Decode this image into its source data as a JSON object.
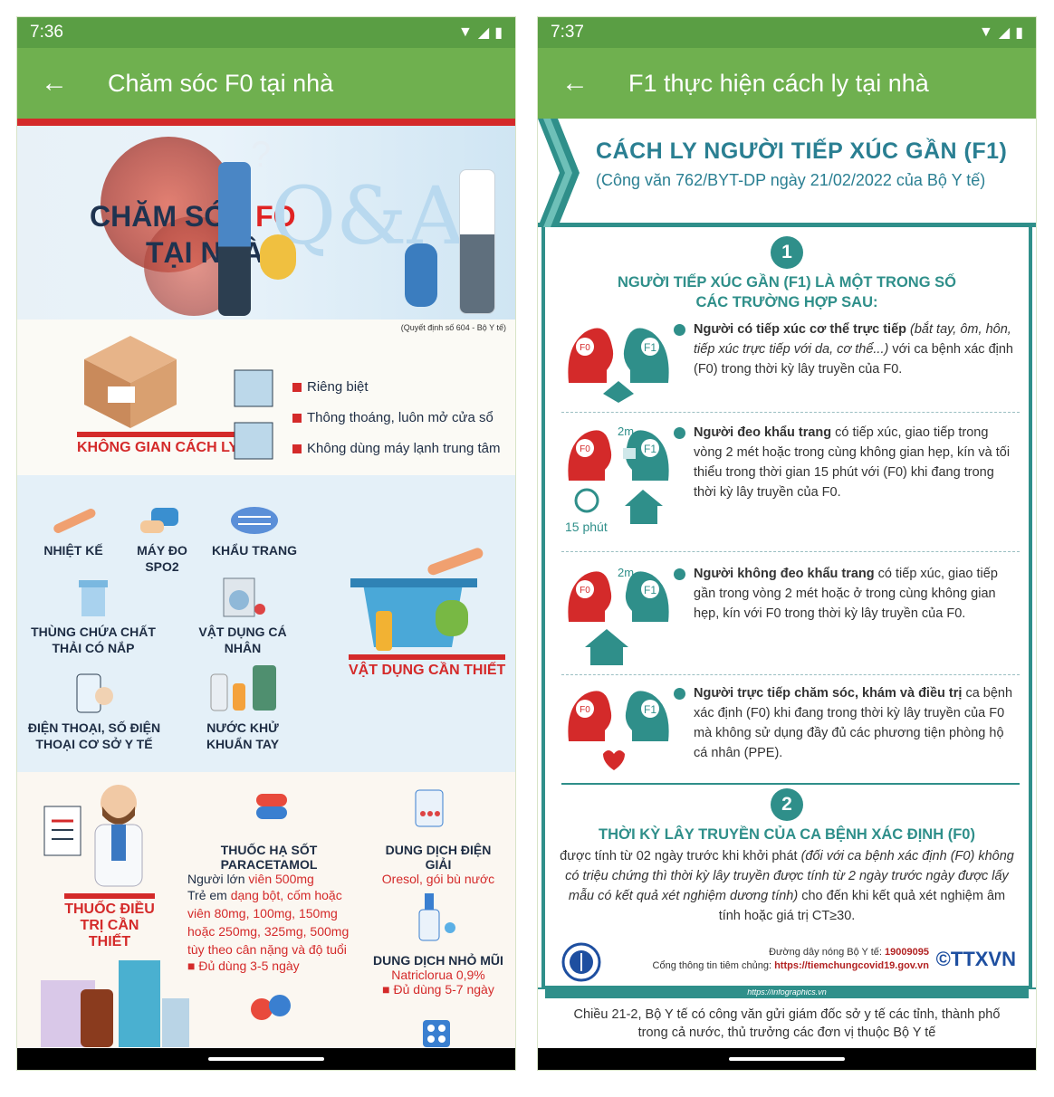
{
  "left": {
    "status": {
      "time": "7:36"
    },
    "appbar": {
      "title": "Chăm sóc F0 tại nhà"
    },
    "hero": {
      "line1": "CHĂM SÓC ",
      "line1_red": "FO",
      "line2": "TẠI NHÀ",
      "qa": "Q&A",
      "source": "(Quyết định số 604 - Bộ Y tế)"
    },
    "isolation": {
      "label": "KHÔNG GIAN CÁCH LY",
      "bullets": [
        "Riêng biệt",
        "Thông thoáng, luôn mở cửa sổ",
        "Không dùng máy lạnh trung tâm"
      ]
    },
    "supplies": {
      "label": "VẬT DỤNG CẦN THIẾT",
      "items": {
        "thermometer": "NHIỆT KẾ",
        "spo2": "MÁY ĐO SPO2",
        "mask": "KHẨU TRANG",
        "bin": "THÙNG CHỨA CHẤT THẢI CÓ NẮP",
        "personal": "VẬT DỤNG CÁ NHÂN",
        "phone": "ĐIỆN THOẠI, SỐ ĐIỆN THOẠI CƠ SỞ Y TẾ",
        "sanitizer": "NƯỚC KHỬ KHUẨN TAY"
      }
    },
    "medicine": {
      "label": "THUỐC ĐIỀU TRỊ CẦN THIẾT",
      "para_title": "THUỐC HẠ SỐT PARACETAMOL",
      "para_adult_prefix": "Người lớn ",
      "para_adult": "viên 500mg",
      "para_child_prefix": "Trẻ em ",
      "para_child": "dạng bột, cốm hoặc viên 80mg, 100mg, 150mg hoặc 250mg, 325mg, 500mg tùy theo cân nặng và độ tuổi",
      "para_days": "Đủ dùng 3-5 ngày",
      "oresol_title": "DUNG DỊCH ĐIỆN GIẢI",
      "oresol_sub": "Oresol, gói bù nước",
      "nasal_title": "DUNG DỊCH NHỎ MŨI",
      "nasal_sub": "Natriclorua 0,9%",
      "nasal_days": "Đủ dùng 5-7 ngày"
    }
  },
  "right": {
    "status": {
      "time": "7:37"
    },
    "appbar": {
      "title": "F1 thực hiện cách ly tại nhà"
    },
    "header": {
      "title": "CÁCH LY NGƯỜI TIẾP XÚC GẦN (F1)",
      "subtitle": "(Công văn 762/BYT-DP ngày 21/02/2022 của Bộ Y tế)"
    },
    "section1": {
      "number": "1",
      "heading": "NGƯỜI TIẾP XÚC GẦN (F1) LÀ MỘT TRONG SỐ CÁC TRƯỜNG HỢP SAU:",
      "icon_labels": {
        "f0": "F0",
        "f1": "F1",
        "distance": "2m",
        "time": "15 phút"
      },
      "cases": [
        {
          "bold": "Người có tiếp xúc cơ thể trực tiếp",
          "italic": " (bắt tay, ôm, hôn, tiếp xúc trực tiếp với da, cơ thể...)",
          "rest": " với ca bệnh xác định (F0) trong thời kỳ lây truyền của F0."
        },
        {
          "bold": "Người đeo khẩu trang",
          "italic": "",
          "rest": " có tiếp xúc, giao tiếp trong vòng 2 mét hoặc trong cùng không gian hẹp, kín và tối thiểu trong thời gian 15 phút với (F0) khi đang trong thời kỳ lây truyền của F0."
        },
        {
          "bold": "Người không đeo khẩu trang",
          "italic": "",
          "rest": " có tiếp xúc, giao tiếp gần trong vòng 2 mét hoặc ở trong cùng không gian hẹp, kín với F0 trong thời kỳ lây truyền của F0."
        },
        {
          "bold": "Người trực tiếp chăm sóc, khám và điều trị",
          "italic": "",
          "rest": " ca bệnh xác định (F0) khi đang trong thời kỳ lây truyền của F0 mà không sử dụng đầy đủ các phương tiện phòng hộ cá nhân (PPE)."
        }
      ]
    },
    "section2": {
      "number": "2",
      "heading": "THỜI KỲ LÂY TRUYỀN CỦA CA BỆNH XÁC ĐỊNH (F0)",
      "p_start": "được tính từ 02 ngày trước khi khởi phát ",
      "p_italic": "(đối với ca bệnh xác định (F0) không có triệu chứng thì thời kỳ lây truyền được tính từ 2 ngày trước ngày được lấy mẫu có kết quả xét nghiệm dương tính)",
      "p_end": " cho đến khi kết quả xét nghiệm âm tính hoặc giá trị CT≥30."
    },
    "footer": {
      "hotline_label": "Đường dây nóng Bộ Y tế: ",
      "hotline": "19009095",
      "portal_label": "Cổng thông tin tiêm chủng: ",
      "portal": "https://tiemchungcovid19.gov.vn",
      "brand": "TTXVN",
      "site": "https://infographics.vn"
    },
    "news": "Chiều 21-2, Bộ Y tế có công văn gửi giám đốc sở y tế các tỉnh, thành phố trong cả nước, thủ trưởng các đơn vị thuộc Bộ Y tế"
  }
}
